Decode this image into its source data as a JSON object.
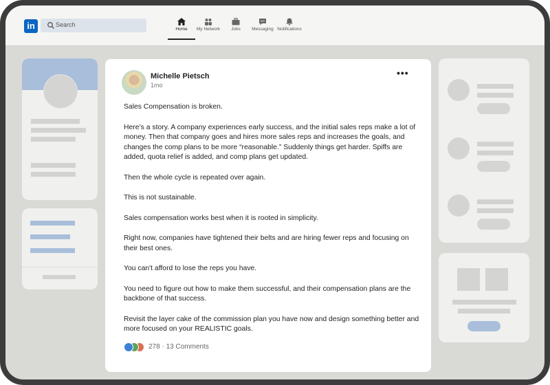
{
  "nav": {
    "logo_text": "in",
    "search_placeholder": "Search",
    "items": [
      {
        "label": "Home",
        "icon": "home-icon",
        "active": true
      },
      {
        "label": "My Network",
        "icon": "network-icon"
      },
      {
        "label": "Jobs",
        "icon": "briefcase-icon"
      },
      {
        "label": "Messaging",
        "icon": "messaging-icon"
      },
      {
        "label": "Notifications",
        "icon": "bell-icon"
      }
    ]
  },
  "post": {
    "author": "Michelle Pietsch",
    "time": "1mo",
    "paragraphs": [
      "Sales Compensation is broken.",
      "Here’s a story. A company experiences early success, and the initial sales reps make a lot of money. Then that company goes and hires more sales reps and increases the goals, and changes the comp plans to be more “reasonable.” Suddenly things get harder. Spiffs are added, quota relief is added, and comp plans get updated.",
      "Then the whole cycle is repeated over again.",
      "This is not sustainable.",
      "Sales compensation works best when it is rooted in simplicity.",
      "Right now, companies have tightened their belts and are hiring fewer reps and focusing on their best ones.",
      "You can't afford to lose the reps you have.",
      "You need to figure out how to make them successful, and their compensation plans are the backbone of that success.",
      "Revisit the layer cake of the commission plan you have now and design something better and more focused on your REALISTIC goals."
    ],
    "reaction_count": "278",
    "comments": "13 Comments",
    "separator": "·"
  },
  "colors": {
    "brand": "#0a66c2",
    "frame": "#3c3c3c",
    "placeholder": "#d2d2d0",
    "placeholder_blue": "#a8bedb"
  }
}
